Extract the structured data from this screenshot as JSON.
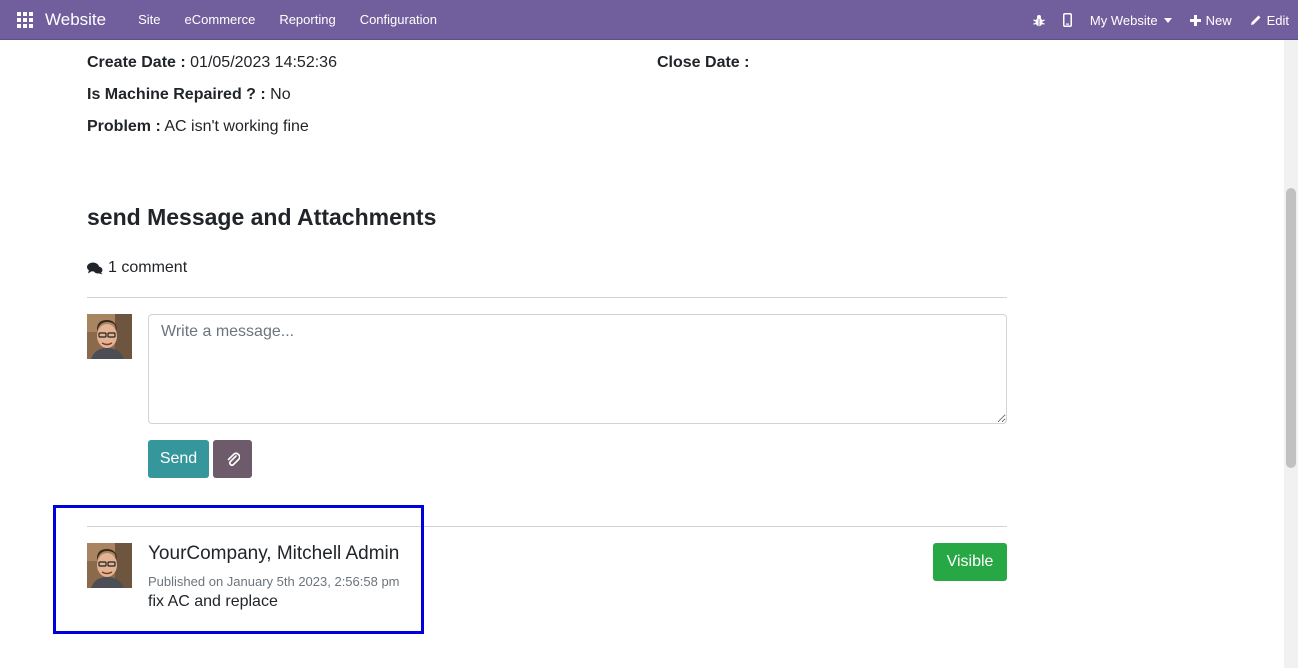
{
  "navbar": {
    "brand": "Website",
    "menu": [
      "Site",
      "eCommerce",
      "Reporting",
      "Configuration"
    ],
    "website_selector": "My Website",
    "new_label": "New",
    "edit_label": "Edit",
    "bg_color": "#715f9d"
  },
  "details": {
    "create_date_label": "Create Date :",
    "create_date_value": "01/05/2023 14:52:36",
    "close_date_label": "Close Date :",
    "close_date_value": "",
    "repaired_label": "Is Machine Repaired ? :",
    "repaired_value": "No",
    "problem_label": "Problem :",
    "problem_value": "AC isn't working fine"
  },
  "chatter": {
    "title": "send Message and Attachments",
    "comment_count": "1 comment",
    "message_placeholder": "Write a message...",
    "send_label": "Send",
    "send_color": "#35979c",
    "attach_color": "#6d5b6b"
  },
  "comment": {
    "author": "YourCompany, Mitchell Admin",
    "published": "Published on January 5th 2023, 2:56:58 pm",
    "body": "fix AC and replace",
    "visibility_label": "Visible",
    "visibility_color": "#28a745"
  },
  "highlight_color": "#0000dd"
}
